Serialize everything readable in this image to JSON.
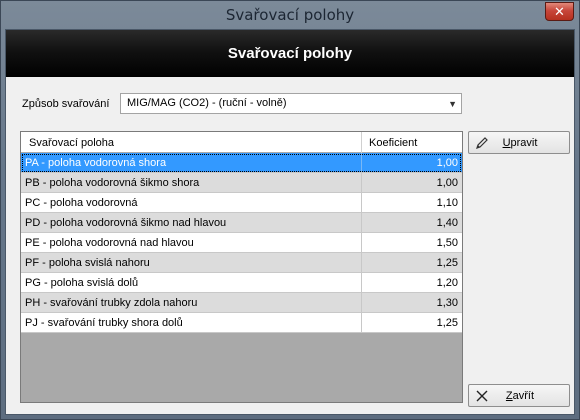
{
  "window": {
    "title": "Svařovací polohy",
    "close_label": "✕"
  },
  "banner": {
    "title": "Svařovací polohy"
  },
  "method": {
    "label": "Způsob svařování",
    "selected": "MIG/MAG (CO2) - (ruční - volně)"
  },
  "table": {
    "headers": [
      "Svařovací poloha",
      "Koeficient"
    ],
    "rows": [
      [
        "PA - poloha vodorovná shora",
        "1,00"
      ],
      [
        "PB - poloha vodorovná šikmo shora",
        "1,00"
      ],
      [
        "PC - poloha vodorovná",
        "1,10"
      ],
      [
        "PD - poloha vodorovná šikmo nad hlavou",
        "1,40"
      ],
      [
        "PE - poloha vodorovná nad hlavou",
        "1,50"
      ],
      [
        "PF - poloha svislá nahoru",
        "1,25"
      ],
      [
        "PG - poloha svislá dolů",
        "1,20"
      ],
      [
        "PH - svařování trubky zdola nahoru",
        "1,30"
      ],
      [
        "PJ - svařování trubky shora dolů",
        "1,25"
      ]
    ]
  },
  "buttons": {
    "edit_first": "U",
    "edit_rest": "pravit",
    "edit_icon": "pencil-icon",
    "close_first": "Z",
    "close_rest": "avřít",
    "close_icon": "x-icon"
  },
  "colors": {
    "selection": "#3399ff",
    "banner": "#000000",
    "alt_row": "#dcdcdc"
  }
}
